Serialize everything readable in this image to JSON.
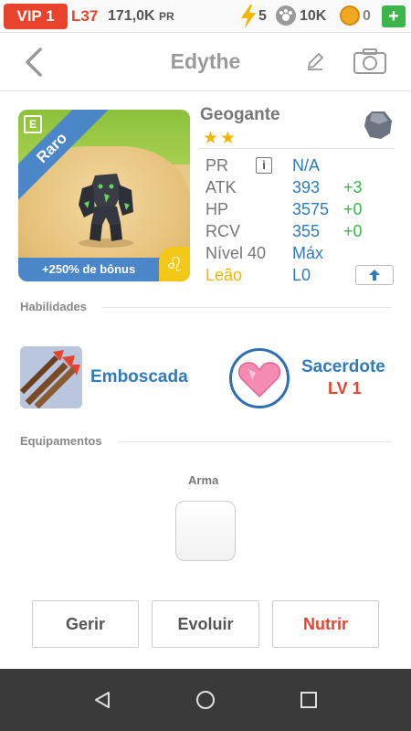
{
  "status": {
    "vip": "VIP 1",
    "level": "L37",
    "pr_value": "171,0K",
    "pr_unit": "PR",
    "energy": "5",
    "paws": "10K",
    "coins": "0",
    "plus": "+"
  },
  "header": {
    "title": "Edythe"
  },
  "card": {
    "rarity": "Raro",
    "bonus": "+250% de bônus",
    "badge": "E"
  },
  "monster": {
    "species": "Geogante",
    "stars": "★★",
    "stats": [
      {
        "label": "PR",
        "value": "N/A",
        "bonus": ""
      },
      {
        "label": "ATK",
        "value": "393",
        "bonus": "+3"
      },
      {
        "label": "HP",
        "value": "3575",
        "bonus": "+0"
      },
      {
        "label": "RCV",
        "value": "355",
        "bonus": "+0"
      },
      {
        "label": "Nível 40",
        "value": "Máx",
        "bonus": ""
      },
      {
        "label": "Leão",
        "value": "L0",
        "bonus": ""
      }
    ],
    "info_icon": "i"
  },
  "abilities": {
    "title": "Habilidades",
    "skill1": "Emboscada",
    "skill2": "Sacerdote",
    "skill2_level": "LV 1"
  },
  "equipment": {
    "title": "Equipamentos",
    "slot_label": "Arma"
  },
  "actions": {
    "manage": "Gerir",
    "evolve": "Evoluir",
    "feed": "Nutrir"
  },
  "colors": {
    "accent_red": "#e8432c",
    "accent_blue": "#2f7bbd",
    "accent_green": "#3cb54a",
    "accent_gold": "#f2b600"
  }
}
